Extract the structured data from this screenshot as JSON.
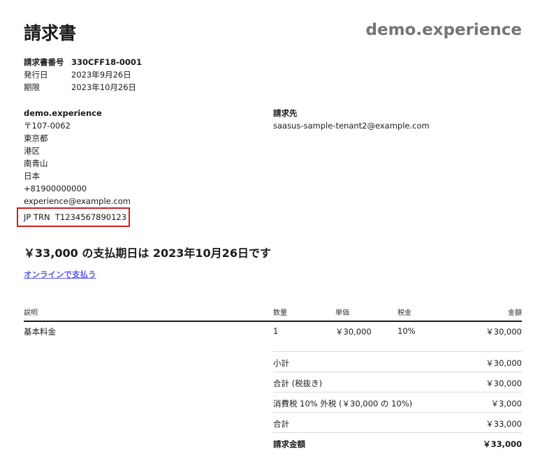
{
  "invoice": {
    "title": "請求書",
    "brand": "demo.experience",
    "meta": [
      {
        "label": "請求書番号",
        "value": "330CFF18-0001"
      },
      {
        "label": "発行日",
        "value": "2023年9月26日"
      },
      {
        "label": "期限",
        "value": "2023年10月26日"
      }
    ]
  },
  "from": {
    "name": "demo.experience",
    "lines": [
      "〒107-0062",
      "東京都",
      "港区",
      "南青山",
      "日本",
      "+81900000000",
      "experience@example.com"
    ],
    "trn": "JP TRN  T1234567890123"
  },
  "bill_to": {
    "label": "請求先",
    "email": "saasus-sample-tenant2@example.com"
  },
  "due_text": "￥33,000 の支払期日は 2023年10月26日です",
  "pay_link": "オンラインで支払う",
  "table": {
    "headers": {
      "description": "説明",
      "quantity": "数量",
      "unit_price": "単価",
      "tax": "税金",
      "amount": "金額"
    },
    "rows": [
      {
        "description": "基本料金",
        "quantity": "1",
        "unit_price": "￥30,000",
        "tax": "10%",
        "amount": "￥30,000"
      }
    ]
  },
  "summary": [
    {
      "label": "小計",
      "value": "￥30,000"
    },
    {
      "label": "合計 (税抜き)",
      "value": "￥30,000"
    },
    {
      "label": "消費税 10% 外税 (￥30,000 の 10%)",
      "value": "￥3,000"
    },
    {
      "label": "合計",
      "value": "￥33,000"
    },
    {
      "label": "請求金額",
      "value": "￥33,000"
    }
  ]
}
